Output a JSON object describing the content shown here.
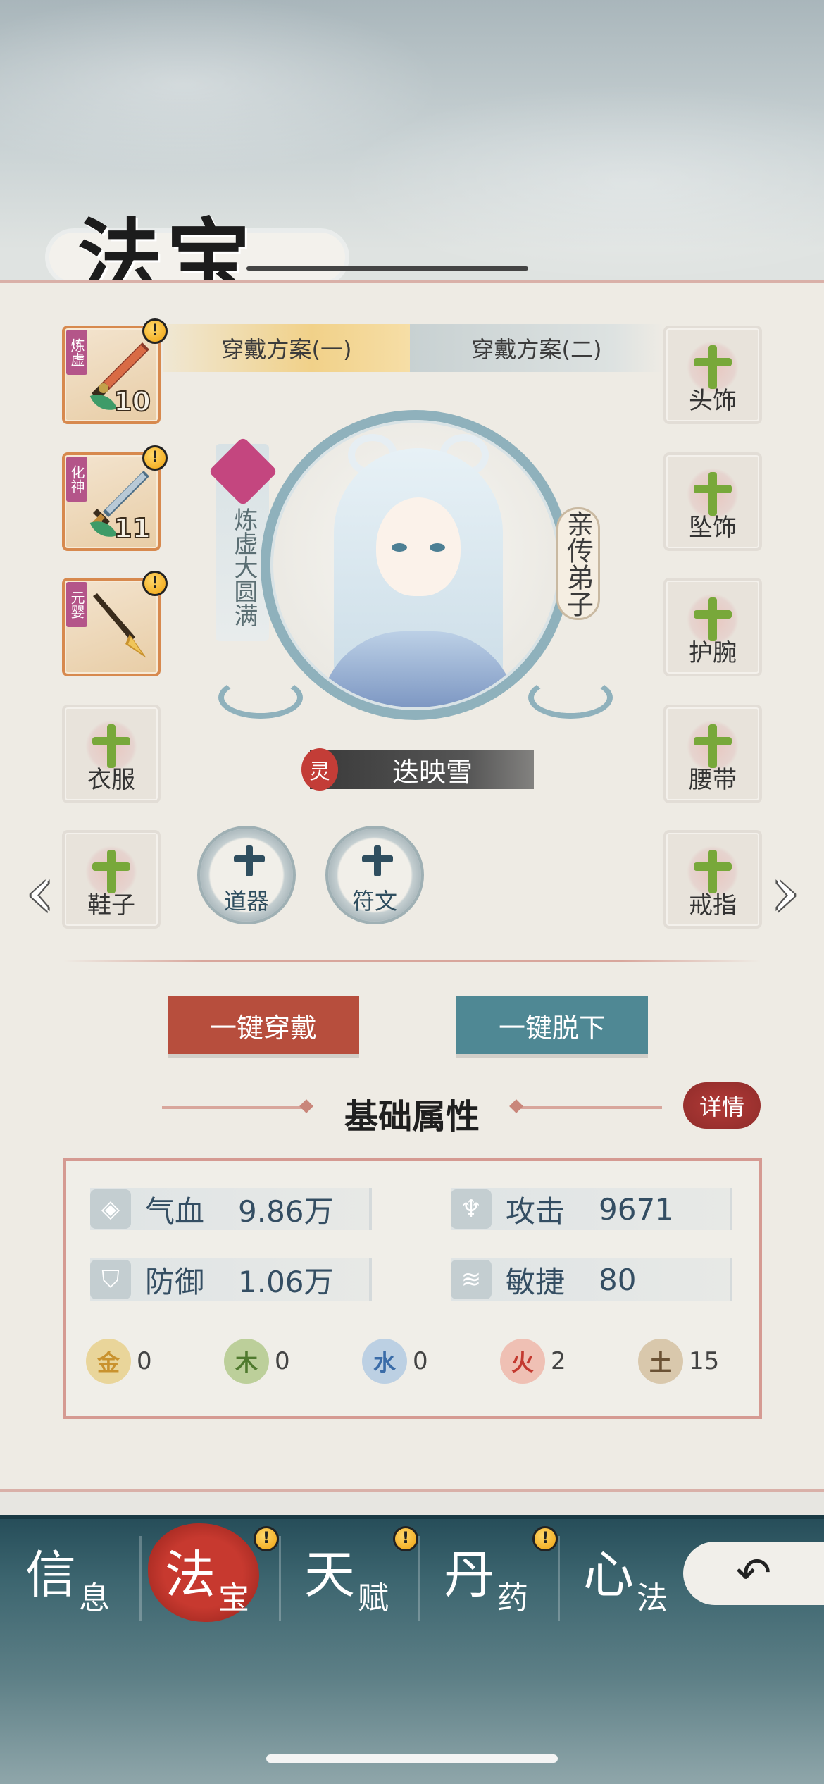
{
  "header": {
    "title": "法宝"
  },
  "tabs": [
    {
      "label": "穿戴方案(一)",
      "active": true
    },
    {
      "label": "穿戴方案(二)",
      "active": false
    }
  ],
  "left_slots": [
    {
      "type": "weapon",
      "rank": "炼虚",
      "level": "10",
      "alert": "!"
    },
    {
      "type": "weapon",
      "rank": "化神",
      "level": "11",
      "alert": "!"
    },
    {
      "type": "weapon",
      "rank": "元婴",
      "level": "",
      "alert": "!"
    },
    {
      "type": "empty",
      "label": "衣服"
    },
    {
      "type": "empty",
      "label": "鞋子"
    }
  ],
  "right_slots": [
    {
      "label": "头饰"
    },
    {
      "label": "坠饰"
    },
    {
      "label": "护腕"
    },
    {
      "label": "腰带"
    },
    {
      "label": "戒指"
    }
  ],
  "character": {
    "realm": "炼虚大圆满",
    "rank": "亲传弟子",
    "spirit_tag": "灵",
    "name": "迭映雪"
  },
  "round_slots": [
    {
      "label": "道器"
    },
    {
      "label": "符文"
    }
  ],
  "buttons": {
    "equip_all": "一键穿戴",
    "remove_all": "一键脱下"
  },
  "stats_section": {
    "title": "基础属性",
    "detail": "详情",
    "stats": [
      {
        "name": "气血",
        "value": "9.86万",
        "icon": "blood-drop-icon"
      },
      {
        "name": "攻击",
        "value": "9671",
        "icon": "sword-hilt-icon"
      },
      {
        "name": "防御",
        "value": "1.06万",
        "icon": "shield-icon"
      },
      {
        "name": "敏捷",
        "value": "80",
        "icon": "wing-icon"
      }
    ],
    "elements": [
      {
        "name": "金",
        "value": "0",
        "color": "#e2bf63"
      },
      {
        "name": "木",
        "value": "0",
        "color": "#8fae5e"
      },
      {
        "name": "水",
        "value": "0",
        "color": "#7aa0c8"
      },
      {
        "name": "火",
        "value": "2",
        "color": "#e08a76"
      },
      {
        "name": "土",
        "value": "15",
        "color": "#b89a72"
      }
    ]
  },
  "bottom_nav": [
    {
      "big": "信",
      "small": "息",
      "active": false,
      "alert": ""
    },
    {
      "big": "法",
      "small": "宝",
      "active": true,
      "alert": "!"
    },
    {
      "big": "天",
      "small": "赋",
      "active": false,
      "alert": "!"
    },
    {
      "big": "丹",
      "small": "药",
      "active": false,
      "alert": "!"
    },
    {
      "big": "心",
      "small": "法",
      "active": false,
      "alert": ""
    }
  ],
  "arrows": {
    "left": "‹",
    "right": "›"
  },
  "back_icon": "↶"
}
